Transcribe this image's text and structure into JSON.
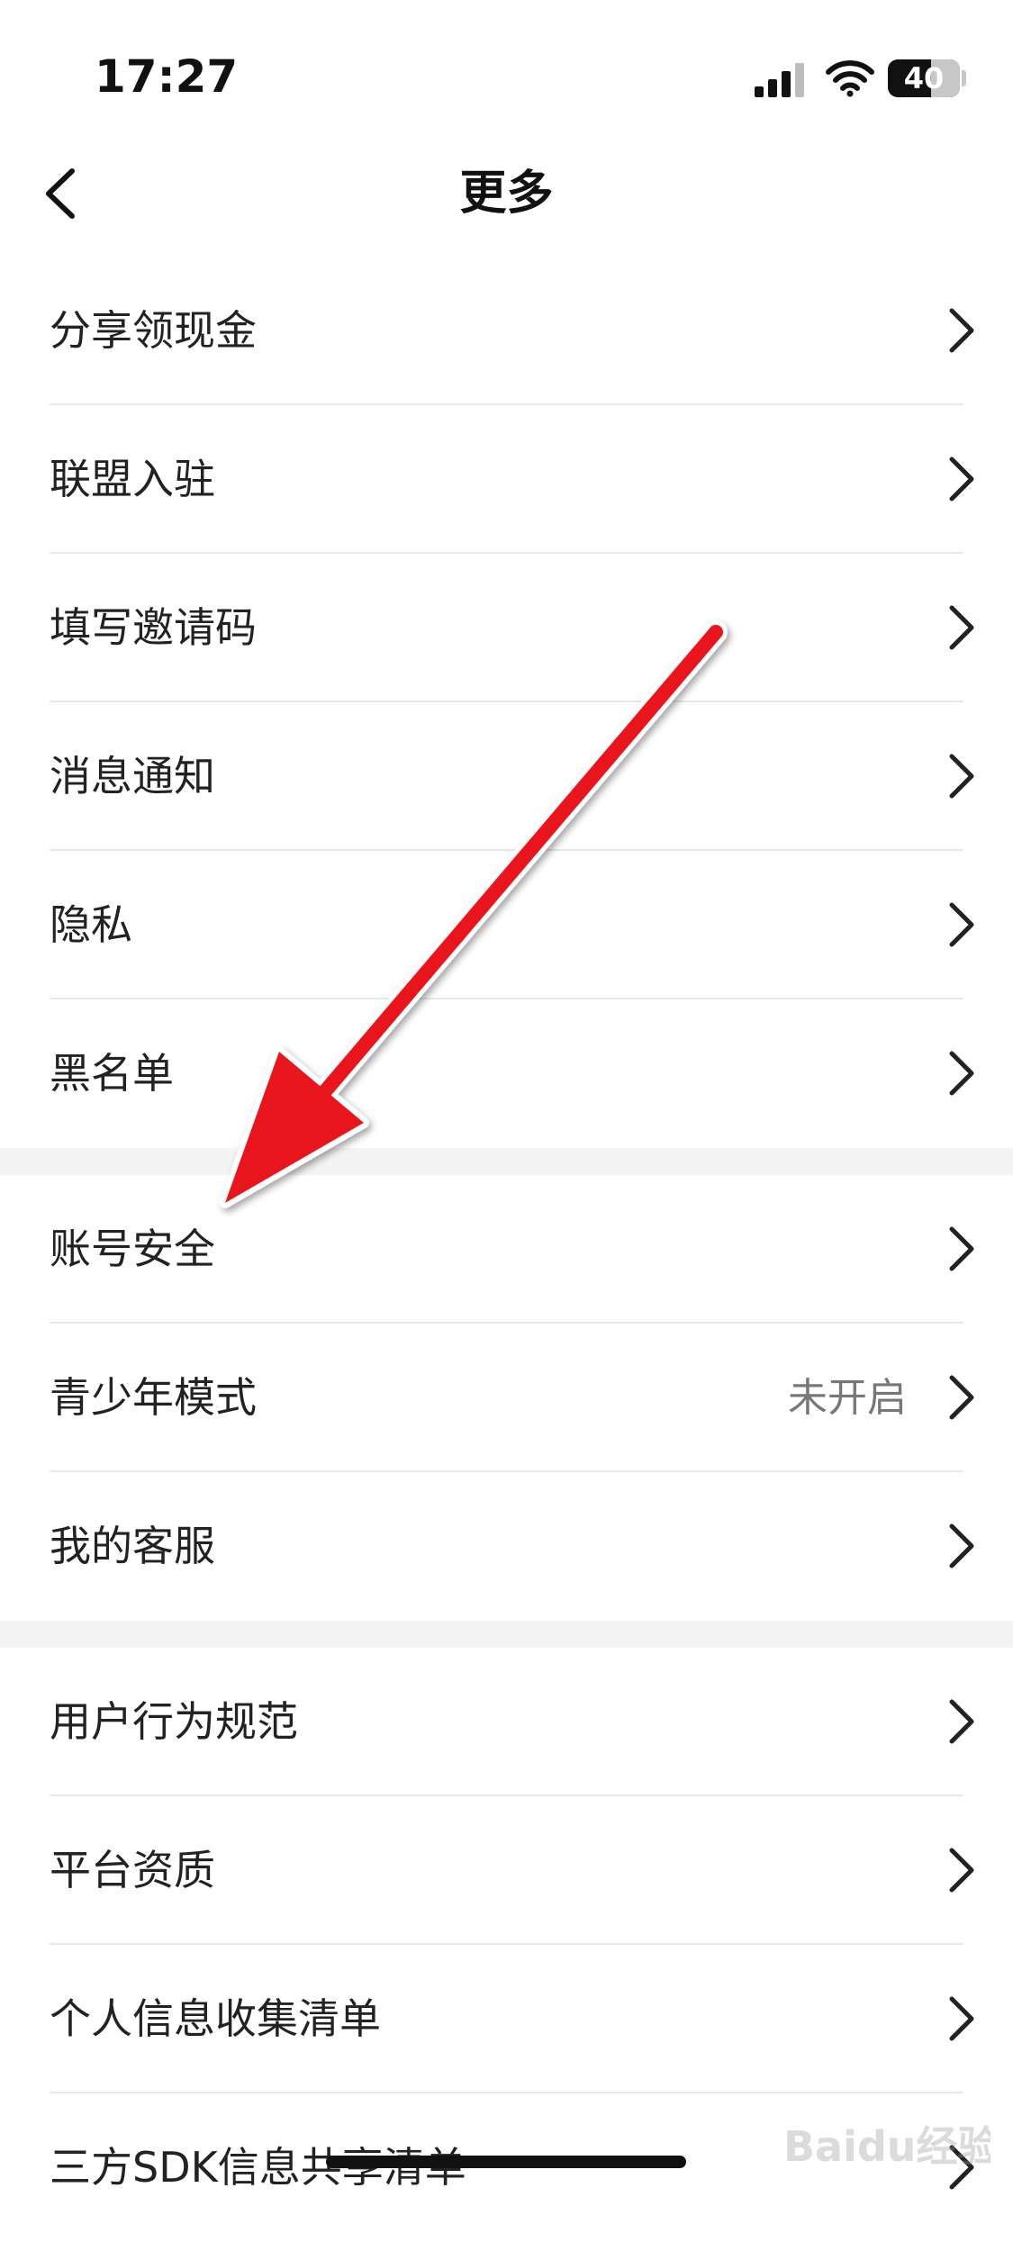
{
  "status_bar": {
    "time": "17:27",
    "battery": "40"
  },
  "nav": {
    "title": "更多"
  },
  "groups": [
    {
      "items": [
        {
          "label": "分享领现金"
        },
        {
          "label": "联盟入驻"
        },
        {
          "label": "填写邀请码"
        },
        {
          "label": "消息通知"
        },
        {
          "label": "隐私"
        },
        {
          "label": "黑名单"
        }
      ]
    },
    {
      "items": [
        {
          "label": "账号安全"
        },
        {
          "label": "青少年模式",
          "value": "未开启"
        },
        {
          "label": "我的客服"
        }
      ]
    },
    {
      "items": [
        {
          "label": "用户行为规范"
        },
        {
          "label": "平台资质"
        },
        {
          "label": "个人信息收集清单"
        },
        {
          "label": "三方SDK信息共享清单"
        }
      ]
    }
  ],
  "overlay": {
    "arrow_color": "#e8141a",
    "watermark": "Baidu经验"
  },
  "icons": [
    "back-chevron-icon",
    "chevron-right-icon",
    "signal-icon",
    "wifi-icon",
    "battery-icon"
  ]
}
